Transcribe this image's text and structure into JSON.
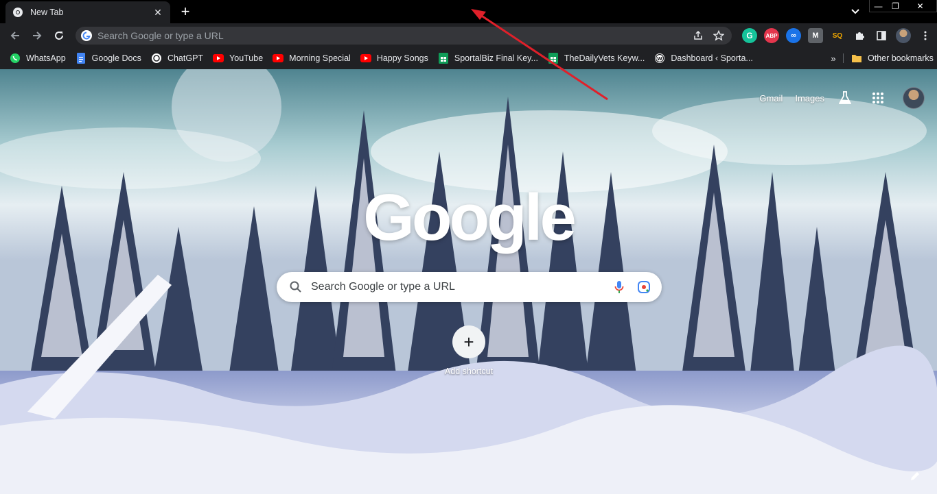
{
  "tab": {
    "title": "New Tab"
  },
  "omnibox": {
    "placeholder": "Search Google or type a URL"
  },
  "extensions": [
    {
      "icon": "grammarly-icon",
      "color": "#15c39a"
    },
    {
      "icon": "adblock-plus-icon",
      "label": "ABP",
      "color": "#e4364d"
    },
    {
      "icon": "infinity-extension-icon",
      "color": "#1a73e8"
    },
    {
      "icon": "m-extension-icon",
      "label": "M",
      "color": "#5f6368"
    },
    {
      "icon": "seoquake-icon",
      "label": "SQ",
      "color": "#f2a900"
    },
    {
      "icon": "puzzle-icon"
    },
    {
      "icon": "side-panel-icon"
    },
    {
      "icon": "profile-avatar"
    },
    {
      "icon": "kebab-menu-icon"
    }
  ],
  "bookmarks": [
    {
      "label": "WhatsApp",
      "icon": "whatsapp-icon",
      "color": "#25d366"
    },
    {
      "label": "Google Docs",
      "icon": "google-docs-icon",
      "color": "#4285f4"
    },
    {
      "label": "ChatGPT",
      "icon": "chatgpt-icon",
      "color": "#ffffff"
    },
    {
      "label": "YouTube",
      "icon": "youtube-icon",
      "color": "#ff0000"
    },
    {
      "label": "Morning Special",
      "icon": "youtube-icon",
      "color": "#ff0000"
    },
    {
      "label": "Happy Songs",
      "icon": "youtube-icon",
      "color": "#ff0000"
    },
    {
      "label": "SportalBiz Final Key...",
      "icon": "google-sheets-icon",
      "color": "#0f9d58"
    },
    {
      "label": "TheDailyVets Keyw...",
      "icon": "google-sheets-icon",
      "color": "#0f9d58"
    },
    {
      "label": "Dashboard ‹ Sporta...",
      "icon": "wordpress-icon",
      "color": "#ffffff"
    }
  ],
  "bookmarks_more": "»",
  "other_bookmarks": "Other bookmarks",
  "ntp": {
    "gmail": "Gmail",
    "images": "Images",
    "logo": "Google",
    "search_placeholder": "Search Google or type a URL",
    "add_shortcut": "Add shortcut"
  },
  "colors": {
    "chrome_dark": "#202124",
    "annotation_arrow": "#e0202a"
  }
}
